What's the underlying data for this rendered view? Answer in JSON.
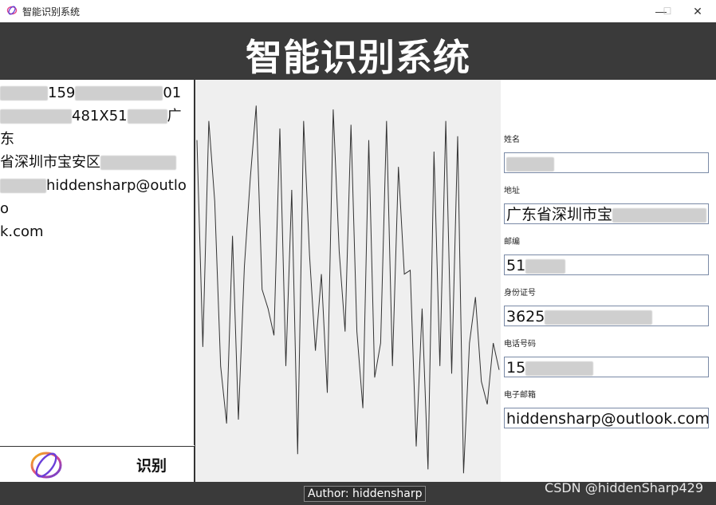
{
  "window": {
    "title": "智能识别系统",
    "minimize_glyph": "—",
    "maximize_glyph": "☐",
    "close_glyph": "✕"
  },
  "header": {
    "title": "智能识别系统"
  },
  "left_panel": {
    "lines": [
      {
        "parts": [
          {
            "t": "blur",
            "w": 60
          },
          {
            "t": "text",
            "v": "159"
          },
          {
            "t": "blur",
            "w": 110
          },
          {
            "t": "text",
            "v": "01"
          }
        ]
      },
      {
        "parts": [
          {
            "t": "blur",
            "w": 90
          },
          {
            "t": "text",
            "v": "481X51"
          },
          {
            "t": "blur",
            "w": 50
          },
          {
            "t": "text",
            "v": "广东"
          }
        ]
      },
      {
        "parts": [
          {
            "t": "text",
            "v": "省深圳市宝安区"
          },
          {
            "t": "blur",
            "w": 95
          }
        ]
      },
      {
        "parts": [
          {
            "t": "blur",
            "w": 58
          },
          {
            "t": "text",
            "v": "hiddensharp@outloo"
          }
        ]
      },
      {
        "parts": [
          {
            "t": "text",
            "v": "k.com"
          }
        ]
      }
    ]
  },
  "actions": {
    "recognize_label": "识别"
  },
  "waveform": {
    "values": [
      0.88,
      0.34,
      0.93,
      0.72,
      0.29,
      0.14,
      0.63,
      0.15,
      0.55,
      0.78,
      0.97,
      0.49,
      0.44,
      0.37,
      0.91,
      0.29,
      0.75,
      0.06,
      0.93,
      0.58,
      0.33,
      0.53,
      0.22,
      0.96,
      0.59,
      0.38,
      0.92,
      0.38,
      0.18,
      0.88,
      0.26,
      0.35,
      0.93,
      0.29,
      0.81,
      0.53,
      0.54,
      0.08,
      0.44,
      0.02,
      0.85,
      0.29,
      0.93,
      0.27,
      0.89,
      0.01,
      0.35,
      0.47,
      0.25,
      0.19,
      0.35,
      0.28
    ]
  },
  "form": {
    "fields": [
      {
        "label": "姓名",
        "value": "",
        "redacted_width": 60
      },
      {
        "label": "地址",
        "value": "广东省深圳市宝",
        "redacted_width": 118
      },
      {
        "label": "邮编",
        "value": "51",
        "redacted_width": 50
      },
      {
        "label": "身份证号",
        "value": "3625",
        "redacted_width": 135
      },
      {
        "label": "电话号码",
        "value": "15",
        "redacted_width": 85
      },
      {
        "label": "电子邮箱",
        "value": "hiddensharp@outlook.com",
        "redacted_width": 0
      }
    ]
  },
  "footer": {
    "author": "Author: hiddensharp"
  },
  "watermark": "CSDN @hiddenSharp429",
  "colors": {
    "header_bg": "#3a3a3a",
    "wave_bg": "#efefef",
    "wave_line": "#333333",
    "input_border": "#7a8aa6"
  }
}
